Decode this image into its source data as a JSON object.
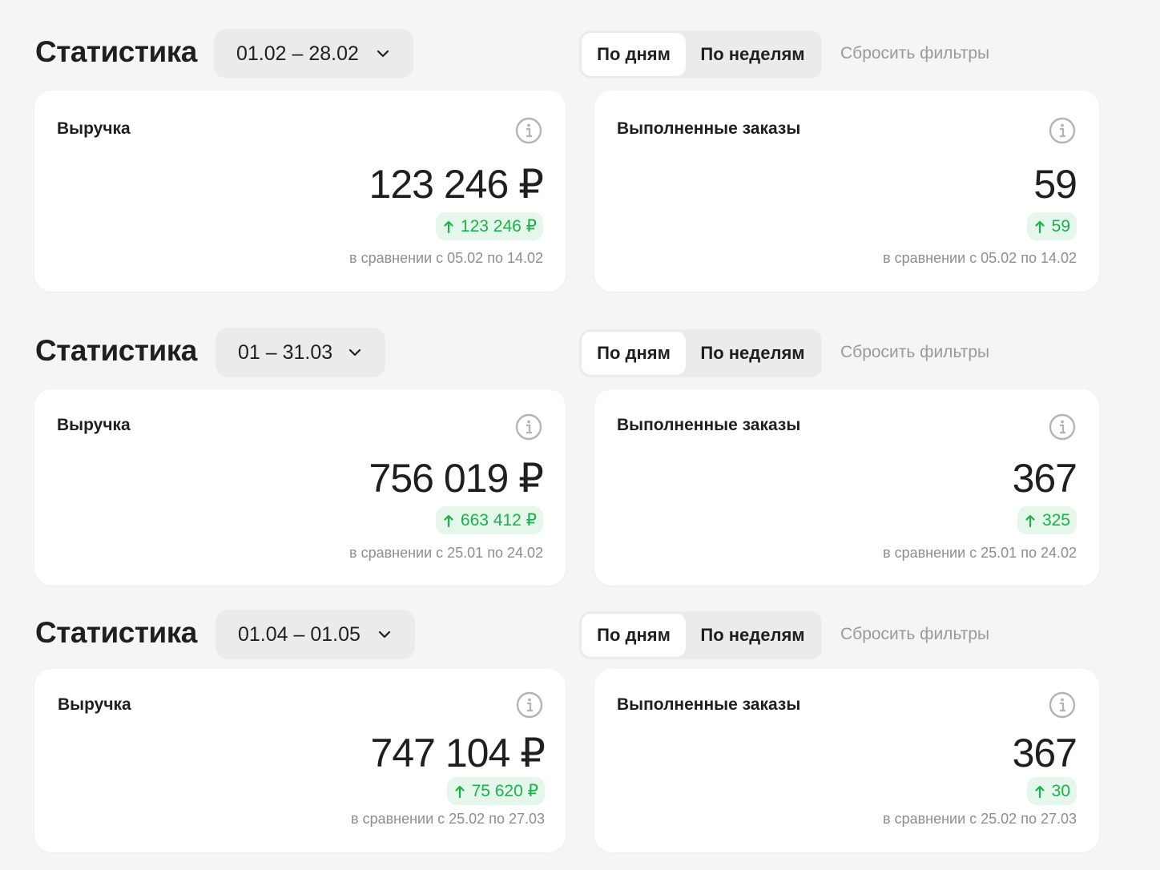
{
  "blocks": [
    {
      "title": "Статистика",
      "period": "01.02 – 28.02",
      "toggle": {
        "days": "По дням",
        "weeks": "По неделям"
      },
      "reset": "Сбросить фильтры",
      "revenue": {
        "label": "Выручка",
        "value": "123 246 ₽",
        "delta": "123 246 ₽",
        "compare": "в сравнении с 05.02 по 14.02"
      },
      "orders": {
        "label": "Выполненные заказы",
        "value": "59",
        "delta": "59",
        "compare": "в сравнении с 05.02 по 14.02"
      }
    },
    {
      "title": "Статистика",
      "period": "01 – 31.03",
      "toggle": {
        "days": "По дням",
        "weeks": "По неделям"
      },
      "reset": "Сбросить фильтры",
      "revenue": {
        "label": "Выручка",
        "value": "756 019 ₽",
        "delta": "663 412 ₽",
        "compare": "в сравнении с 25.01 по 24.02"
      },
      "orders": {
        "label": "Выполненные заказы",
        "value": "367",
        "delta": "325",
        "compare": "в сравнении с 25.01 по 24.02"
      }
    },
    {
      "title": "Статистика",
      "period": "01.04 – 01.05",
      "toggle": {
        "days": "По дням",
        "weeks": "По неделям"
      },
      "reset": "Сбросить фильтры",
      "revenue": {
        "label": "Выручка",
        "value": "747 104 ₽",
        "delta": "75 620 ₽",
        "compare": "в сравнении с 25.02 по 27.03"
      },
      "orders": {
        "label": "Выполненные заказы",
        "value": "367",
        "delta": "30",
        "compare": "в сравнении с 25.02 по 27.03"
      }
    }
  ],
  "colors": {
    "positive": "#19b34b",
    "positive_bg": "#e5f6ea",
    "muted": "#8e8e90"
  },
  "icons": {
    "info": "info-icon",
    "chevron": "chevron-down-icon",
    "arrow": "arrow-up-icon"
  }
}
